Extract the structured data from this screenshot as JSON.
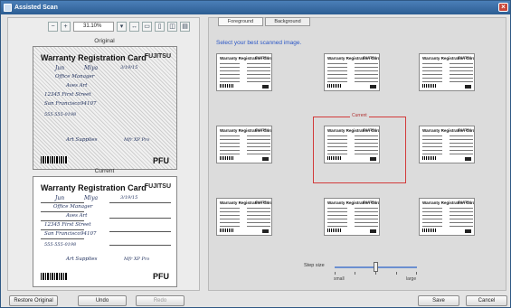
{
  "window": {
    "title": "Assisted Scan"
  },
  "left": {
    "zoom": "31.10%",
    "original_caption": "Original",
    "current_caption": "Current",
    "card": {
      "title": "Warranty Registration Card",
      "logo": "FUJITSU",
      "pfu": "PFU",
      "handwriting": [
        "Jun",
        "Miya",
        "Office Manager",
        "Aves Art",
        "12345 First Street",
        "San Francisco",
        "94107",
        "555-555-0198",
        "Art Supplies",
        "3/19/15",
        "Mfr XP Pro"
      ]
    }
  },
  "right": {
    "tabs": [
      "Foreground",
      "Background"
    ],
    "instruction": "Select your best scanned image.",
    "current_label": "Current",
    "thumb_title": "Warranty Registration Card",
    "thumb_logo": "FUJITSU"
  },
  "step": {
    "label": "Step size",
    "small": "small",
    "large": "large"
  },
  "buttons": {
    "restore": "Restore Original",
    "undo": "Undo",
    "redo": "Redo",
    "save": "Save",
    "cancel": "Cancel"
  }
}
